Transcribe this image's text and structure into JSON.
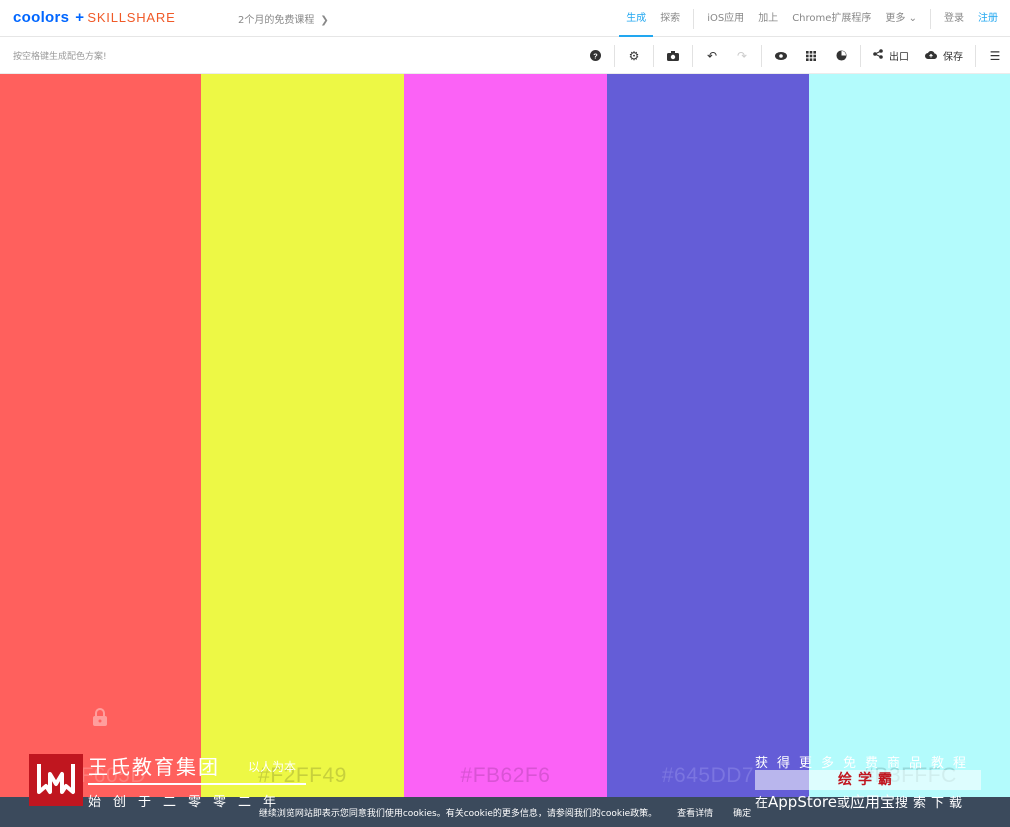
{
  "nav": {
    "logo": "coolors",
    "plus": "+",
    "partner": "SKILLSHARE",
    "promo": "2个月的免费课程",
    "links": [
      "生成",
      "探索",
      "iOS应用",
      "加上",
      "Chrome扩展程序",
      "更多",
      "登录",
      "注册"
    ]
  },
  "toolbar": {
    "hint": "按空格键生成配色方案!",
    "export_label": "出口",
    "save_label": "保存"
  },
  "palette": [
    {
      "hex": "#FF605D",
      "color": "#ff605d",
      "label_color": "#ff7e7b",
      "locked": true
    },
    {
      "hex": "#F2FF49",
      "color": "#edf845",
      "label_color": "#c7d03c"
    },
    {
      "hex": "#FB62F6",
      "color": "#fb62f6",
      "label_color": "#d953d5"
    },
    {
      "hex": "#645DD7",
      "color": "#645dd7",
      "label_color": "#7b75e0"
    },
    {
      "hex": "#B3FFFC",
      "color": "#b3fbfc",
      "label_color": "#97d9da"
    }
  ],
  "cookie": {
    "text": "继续浏览网站即表示您同意我们使用cookies。有关cookie的更多信息，请参阅我们的cookie政策。",
    "details": "查看详情",
    "confirm": "确定"
  },
  "watermark": {
    "name": "王氏教育集团",
    "motto": "以人为本",
    "year": "始创于二零零二年"
  },
  "ad": {
    "top": "获得更多免费商品教程",
    "brand": "绘学霸",
    "bottom_pre": "在",
    "store1": "AppStore",
    "mid": "或",
    "store2": "应用宝",
    "post": "搜索下载"
  }
}
